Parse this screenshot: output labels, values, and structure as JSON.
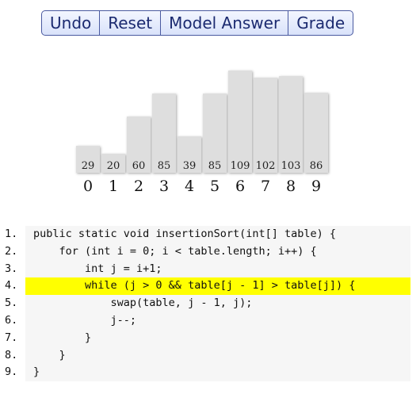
{
  "toolbar": {
    "undo_label": "Undo",
    "reset_label": "Reset",
    "model_answer_label": "Model Answer",
    "grade_label": "Grade"
  },
  "array": {
    "values": [
      "29",
      "20",
      "60",
      "85",
      "39",
      "85",
      "109",
      "102",
      "103",
      "86"
    ],
    "indices": [
      "0",
      "1",
      "2",
      "3",
      "4",
      "5",
      "6",
      "7",
      "8",
      "9"
    ]
  },
  "code": {
    "highlight_line": 4,
    "lines": [
      {
        "num": "1.",
        "text": "public static void insertionSort(int[] table) {"
      },
      {
        "num": "2.",
        "text": "    for (int i = 0; i < table.length; i++) {"
      },
      {
        "num": "3.",
        "text": "        int j = i+1;"
      },
      {
        "num": "4.",
        "text": "        while (j > 0 && table[j - 1] > table[j]) {"
      },
      {
        "num": "5.",
        "text": "            swap(table, j - 1, j);"
      },
      {
        "num": "6.",
        "text": "            j--;"
      },
      {
        "num": "7.",
        "text": "        }"
      },
      {
        "num": "8.",
        "text": "    }"
      },
      {
        "num": "9.",
        "text": "}"
      }
    ]
  },
  "colors": {
    "highlight": "#ffff00",
    "bar_fill": "#dedede",
    "button_text": "#1b2a70"
  }
}
